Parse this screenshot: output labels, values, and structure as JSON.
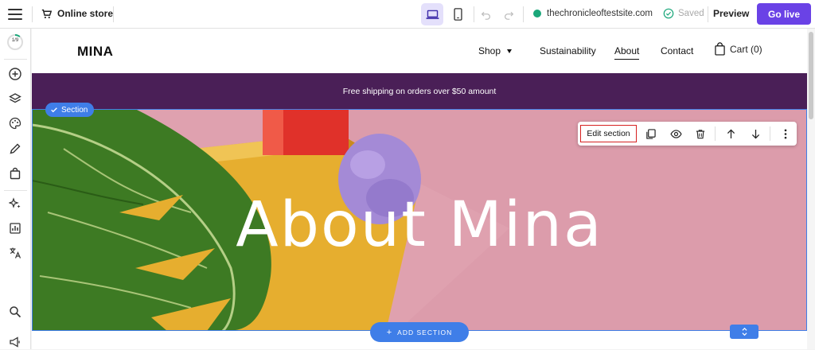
{
  "topbar": {
    "store_label": "Online store",
    "site_url": "thechronicleoftestsite.com",
    "saved_label": "Saved",
    "preview_label": "Preview",
    "golive_label": "Go live"
  },
  "sidebar": {
    "progress_label": "1/9",
    "icons": [
      "add-icon",
      "layers-icon",
      "palette-icon",
      "pen-icon",
      "bag-icon",
      "sparkle-icon",
      "chart-icon",
      "translate-icon",
      "search-icon",
      "megaphone-icon"
    ]
  },
  "site": {
    "logo": "MINA",
    "nav": {
      "shop": "Shop",
      "sustainability": "Sustainability",
      "about": "About",
      "contact": "Contact"
    },
    "cart_label": "Cart (0)",
    "banner_text": "Free shipping on orders over $50 amount",
    "hero_title": "About Mina"
  },
  "editor": {
    "section_tag": "Section",
    "edit_section_label": "Edit section",
    "add_section_label": "ADD SECTION"
  },
  "colors": {
    "accent": "#6a42e6",
    "selection": "#3f7ee8",
    "banner": "#4a1f57",
    "hero_bg": "#dc9cab",
    "highlight": "#d62020"
  }
}
